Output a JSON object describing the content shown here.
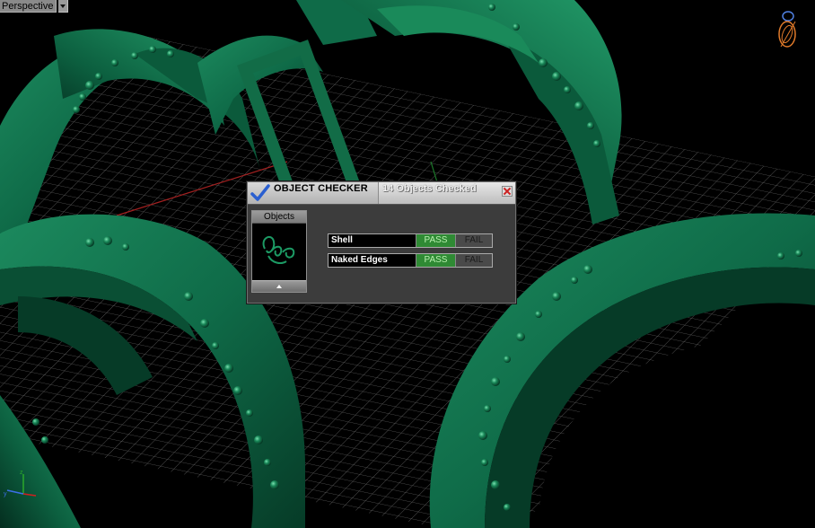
{
  "viewport": {
    "name": "Perspective",
    "background": "#000000",
    "model_color": "#0f6b48",
    "grid_color": "#8a8a8a"
  },
  "checker": {
    "title": "OBJECT CHECKER",
    "count_text": "14  Objects Checked",
    "objects_panel_label": "Objects",
    "checks": [
      {
        "label": "Shell",
        "pass_label": "PASS",
        "fail_label": "FAIL",
        "status": "pass"
      },
      {
        "label": "Naked Edges",
        "pass_label": "PASS",
        "fail_label": "FAIL",
        "status": "pass"
      }
    ],
    "pass_color": "#2f8a34",
    "fail_color": "#4a4a4a"
  },
  "icons": {
    "title_icon": "checkmark-icon",
    "close_icon": "close-icon",
    "scroll_icon": "scroll-up-icon",
    "axis_icon": "axis-triad-icon",
    "corner_icon": "gumball-icon"
  }
}
